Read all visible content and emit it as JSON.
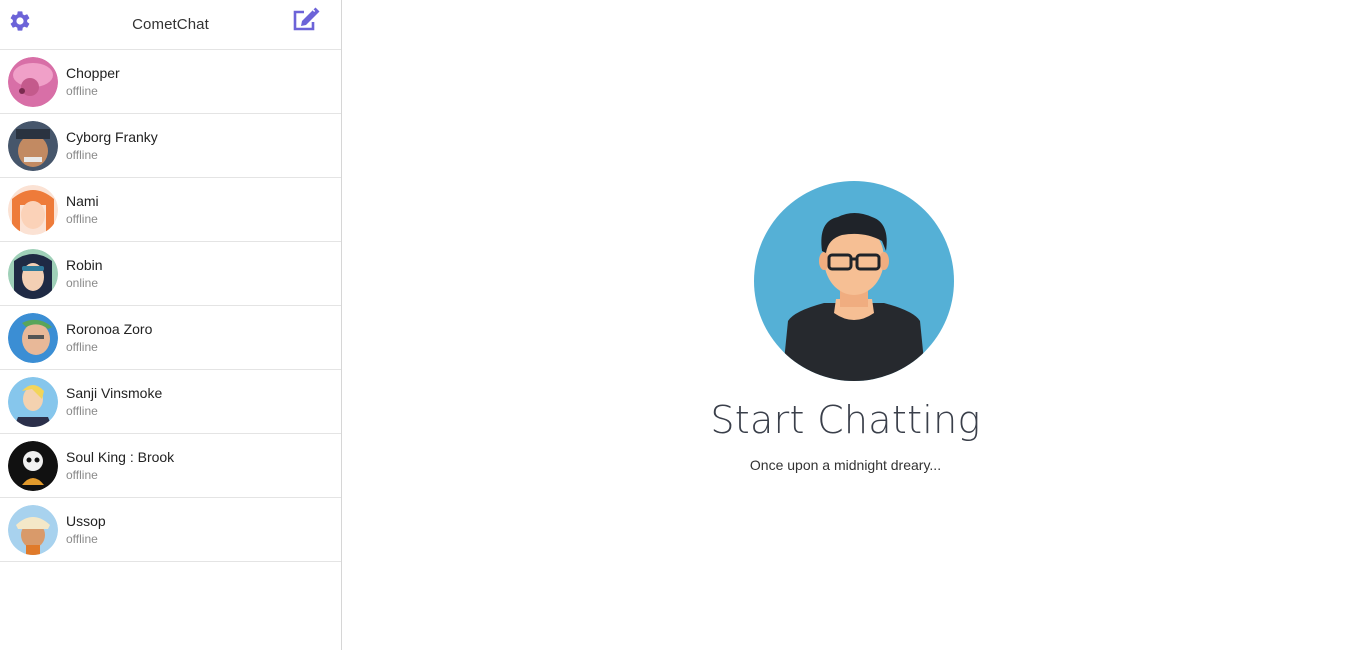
{
  "header": {
    "title": "CometChat",
    "settings_icon": "gear-icon",
    "compose_icon": "compose-icon",
    "accent_color": "#6c63d8"
  },
  "contacts": [
    {
      "name": "Chopper",
      "status": "offline",
      "avatar_color": "#e77fb3"
    },
    {
      "name": "Cyborg Franky",
      "status": "offline",
      "avatar_color": "#3f4a5a"
    },
    {
      "name": "Nami",
      "status": "offline",
      "avatar_color": "#f08a4b"
    },
    {
      "name": "Robin",
      "status": "online",
      "avatar_color": "#2d3e63"
    },
    {
      "name": "Roronoa Zoro",
      "status": "offline",
      "avatar_color": "#3d8fd6"
    },
    {
      "name": "Sanji Vinsmoke",
      "status": "offline",
      "avatar_color": "#7fc0ea"
    },
    {
      "name": "Soul King : Brook",
      "status": "offline",
      "avatar_color": "#1b1b1b"
    },
    {
      "name": "Ussop",
      "status": "offline",
      "avatar_color": "#9fcbe8"
    }
  ],
  "empty_state": {
    "title": "Start Chatting",
    "subtitle": "Once upon a midnight dreary...",
    "illustration": "user-avatar-illustration",
    "circle_color": "#55b0d6"
  }
}
